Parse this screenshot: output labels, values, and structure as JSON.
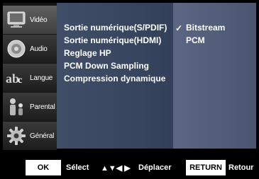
{
  "sidebar": {
    "items": [
      {
        "label": "Vidéo",
        "icon": "tv-icon",
        "active": true
      },
      {
        "label": "Audio",
        "icon": "speaker-icon",
        "active": false
      },
      {
        "label": "Langue",
        "icon": "language-icon",
        "active": false
      },
      {
        "label": "Parental",
        "icon": "family-icon",
        "active": false
      },
      {
        "label": "Général",
        "icon": "gear-icon",
        "active": false
      }
    ]
  },
  "menu": {
    "items": [
      "Sortie numérique(S/PDIF)",
      "Sortie numérique(HDMI)",
      "Reglage HP",
      "PCM Down Sampling",
      "Compression dynamique"
    ]
  },
  "options": {
    "check": "✓",
    "items": [
      "Bitstream",
      "PCM"
    ],
    "selected": "Bitstream"
  },
  "footer": {
    "ok_key": "OK",
    "select_label": "Sélect",
    "arrows": "▲▼◀ ▶",
    "move_label": "Déplacer",
    "return_key": "RETURN",
    "return_label": "Retour"
  },
  "colors": {
    "menu_panel": "#3b4862",
    "value_panel": "#56627c",
    "key_bg": "#ffffff"
  }
}
